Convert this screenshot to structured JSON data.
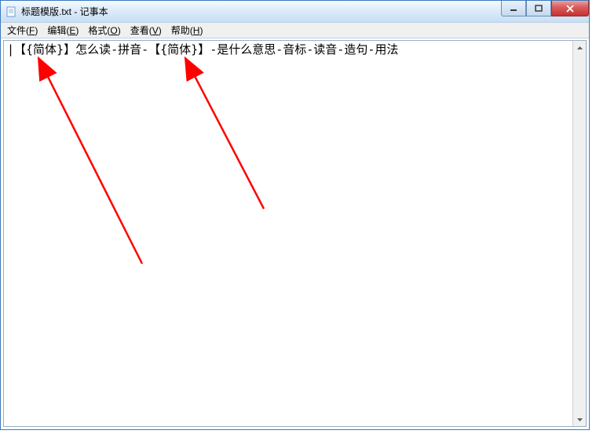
{
  "window": {
    "title": "标题模版.txt - 记事本"
  },
  "menubar": {
    "items": [
      {
        "label": "文件",
        "accel": "F"
      },
      {
        "label": "编辑",
        "accel": "E"
      },
      {
        "label": "格式",
        "accel": "O"
      },
      {
        "label": "查看",
        "accel": "V"
      },
      {
        "label": "帮助",
        "accel": "H"
      }
    ]
  },
  "content": {
    "text": "|【{简体}】怎么读-拼音-【{简体}】-是什么意思-音标-读音-造句-用法"
  },
  "annotations": {
    "color": "#ff0000"
  }
}
